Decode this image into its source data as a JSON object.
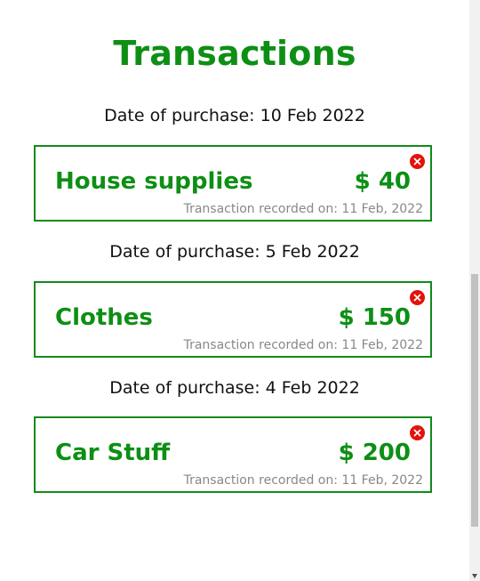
{
  "page": {
    "title": "Transactions"
  },
  "transactions": [
    {
      "date_label": "Date of purchase: 10 Feb 2022",
      "name": "House supplies",
      "amount": "$ 40",
      "recorded": "Transaction recorded on: 11 Feb, 2022"
    },
    {
      "date_label": "Date of purchase: 5 Feb 2022",
      "name": "Clothes",
      "amount": "$ 150",
      "recorded": "Transaction recorded on: 11 Feb, 2022"
    },
    {
      "date_label": "Date of purchase: 4 Feb 2022",
      "name": "Car Stuff",
      "amount": "$ 200",
      "recorded": "Transaction recorded on: 11 Feb, 2022"
    }
  ],
  "icons": {
    "delete": "close-circle-icon",
    "scroll_down": "chevron-down-icon"
  },
  "colors": {
    "accent_green": "#0d8f14",
    "border_green": "#138a1c",
    "delete_red": "#e3120b",
    "muted_text": "#888888"
  }
}
